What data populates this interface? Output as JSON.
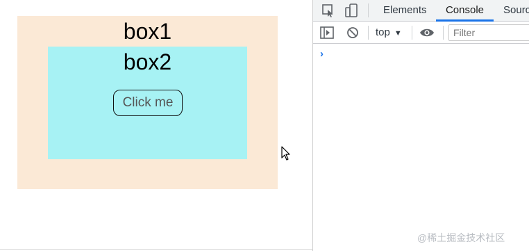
{
  "page": {
    "box1_label": "box1",
    "box2_label": "box2",
    "button_label": "Click me",
    "colors": {
      "box1_bg": "#fbe9d6",
      "box2_bg": "#a7f2f4"
    }
  },
  "devtools": {
    "tabs": [
      {
        "label": "Elements",
        "active": false
      },
      {
        "label": "Console",
        "active": true
      },
      {
        "label": "Sourc",
        "active": false
      }
    ],
    "toolbar": {
      "context": "top",
      "filter_placeholder": "Filter"
    },
    "prompt_symbol": "›",
    "watermark": "@稀土掘金技术社区",
    "icons": [
      "inspect-element-icon",
      "device-toolbar-icon",
      "sidebar-toggle-icon",
      "clear-console-icon",
      "eye-icon",
      "dropdown-arrow-icon"
    ],
    "accent": "#1a73e8"
  }
}
